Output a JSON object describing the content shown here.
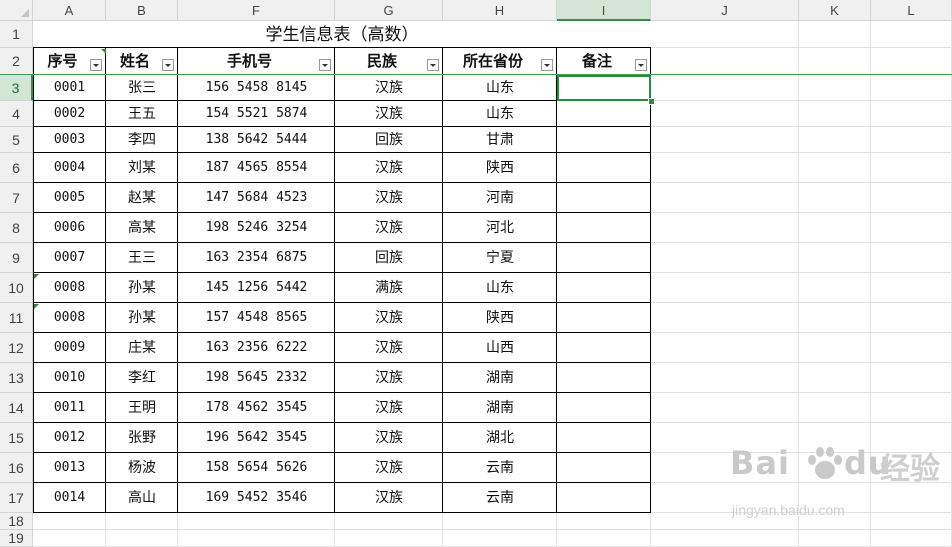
{
  "columns": [
    "A",
    "B",
    "F",
    "G",
    "H",
    "I",
    "J",
    "K",
    "L"
  ],
  "rows": [
    "1",
    "2",
    "3",
    "4",
    "5",
    "6",
    "7",
    "8",
    "9",
    "10",
    "11",
    "12",
    "13",
    "14",
    "15",
    "16",
    "17",
    "18",
    "19"
  ],
  "active_column": "I",
  "active_row": "3",
  "title": "学生信息表（高数）",
  "headers": [
    "序号",
    "姓名",
    "手机号",
    "民族",
    "所在省份",
    "备注"
  ],
  "records": [
    [
      "0001",
      "张三",
      "156 5458 8145",
      "汉族",
      "山东"
    ],
    [
      "0002",
      "王五",
      "154 5521 5874",
      "汉族",
      "山东"
    ],
    [
      "0003",
      "李四",
      "138 5642 5444",
      "回族",
      "甘肃"
    ],
    [
      "0004",
      "刘某",
      "187 4565 8554",
      "汉族",
      "陕西"
    ],
    [
      "0005",
      "赵某",
      "147 5684 4523",
      "汉族",
      "河南"
    ],
    [
      "0006",
      "高某",
      "198 5246 3254",
      "汉族",
      "河北"
    ],
    [
      "0007",
      "王三",
      "163 2354 6875",
      "回族",
      "宁夏"
    ],
    [
      "0008",
      "孙某",
      "145 1256 5442",
      "满族",
      "山东"
    ],
    [
      "0008",
      "孙某",
      "157 4548 8565",
      "汉族",
      "陕西"
    ],
    [
      "0009",
      "庄某",
      "163 2356 6222",
      "汉族",
      "山西"
    ],
    [
      "0010",
      "李红",
      "198 5645 2332",
      "汉族",
      "湖南"
    ],
    [
      "0011",
      "王明",
      "178 4562 3545",
      "汉族",
      "湖南"
    ],
    [
      "0012",
      "张野",
      "196 5642 3545",
      "汉族",
      "湖北"
    ],
    [
      "0013",
      "杨波",
      "158 5654 5626",
      "汉族",
      "云南"
    ],
    [
      "0014",
      "高山",
      "169 5452 3546",
      "汉族",
      "云南"
    ]
  ],
  "watermark": {
    "logo_text": "Bai",
    "logo_text_2": "du",
    "logo_cn": "经验",
    "url": "jingyan.baidu.com"
  },
  "colors": {
    "selection": "#2a8a3e",
    "header_bg": "#f0f0f0",
    "active_header_bg": "#d3e6d6"
  }
}
